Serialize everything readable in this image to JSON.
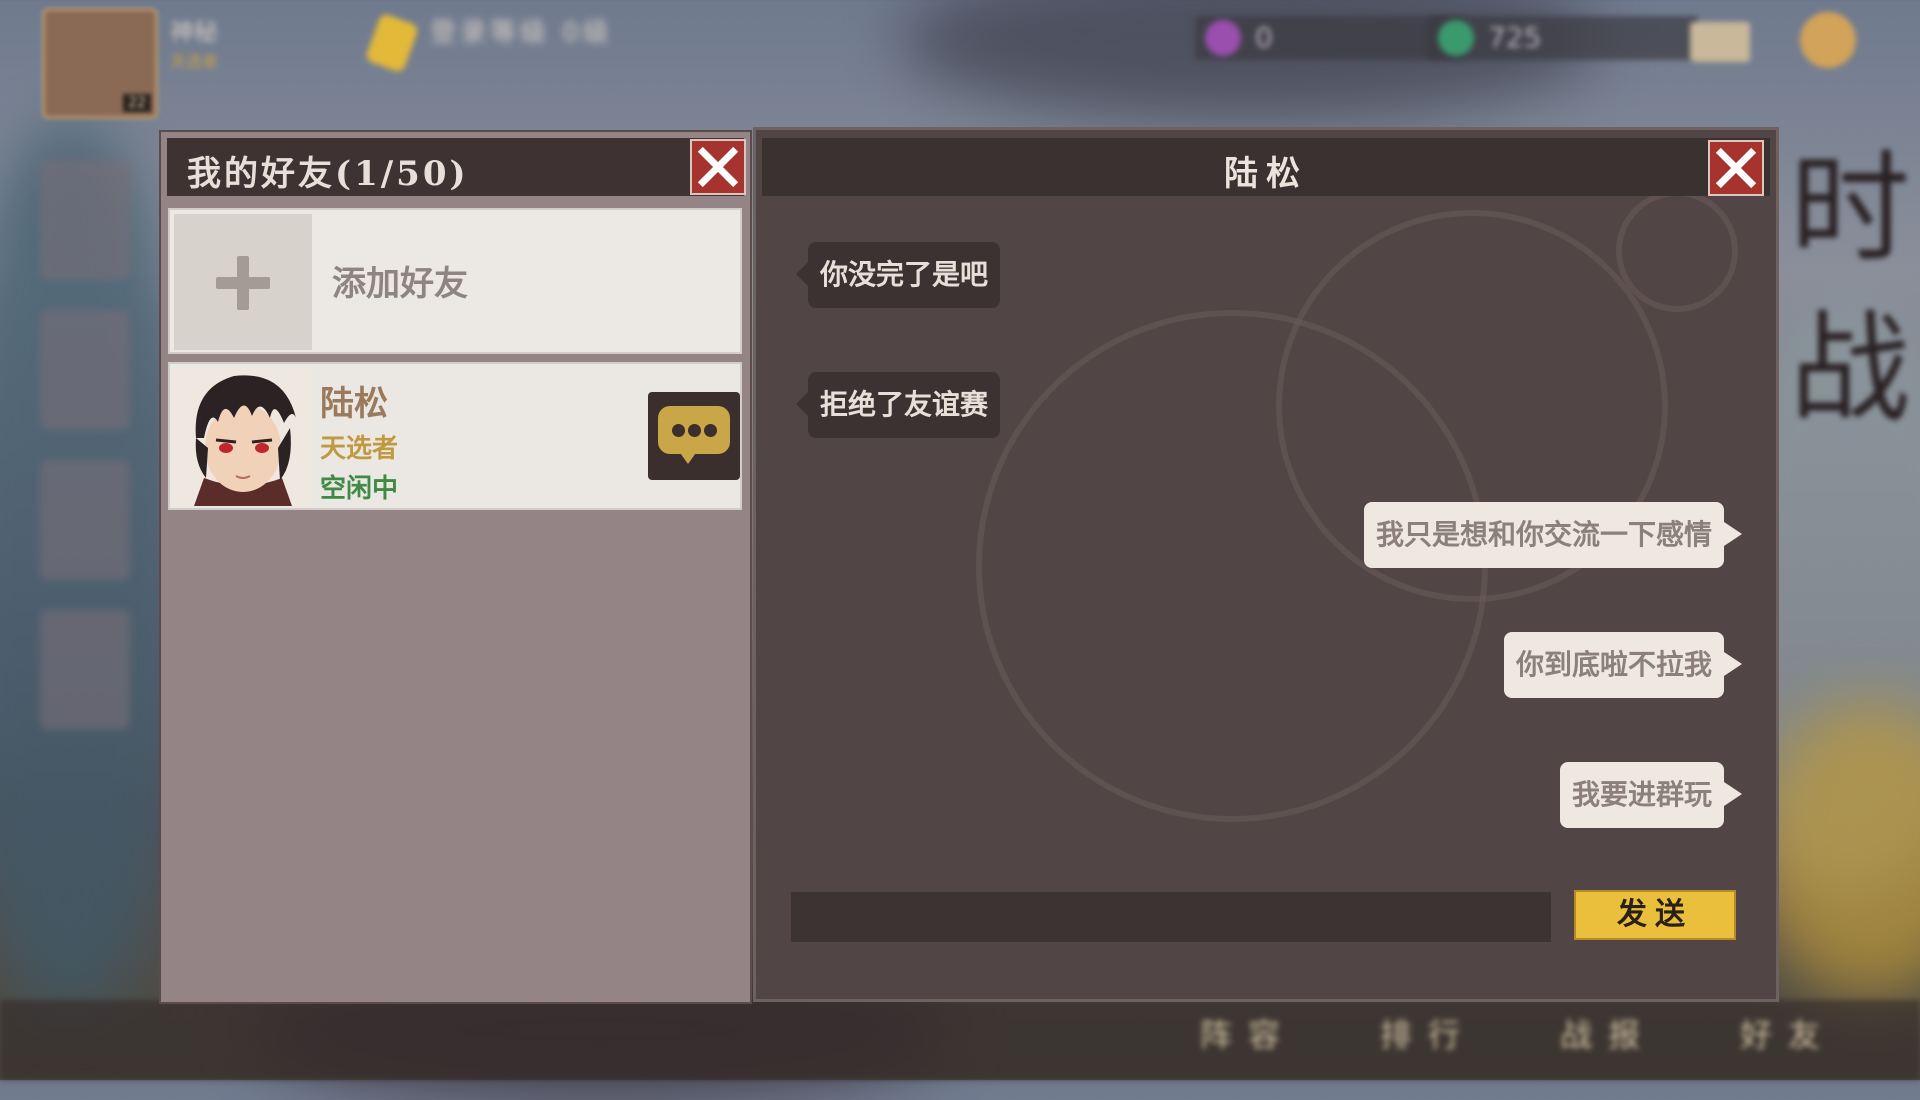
{
  "background": {
    "top_name": "神秘",
    "top_sub": "天选者",
    "top_title": "登录等级 0级",
    "level_badge": "22",
    "resource_1": "0",
    "resource_2": "725",
    "right_text": "时战",
    "bottom_tabs": [
      "阵容",
      "排行",
      "战报",
      "好友"
    ]
  },
  "friends_panel": {
    "title": "我的好友(1/50)",
    "add_friend_label": "添加好友",
    "friends": [
      {
        "name": "陆松",
        "title": "天选者",
        "status": "空闲中"
      }
    ]
  },
  "chat_panel": {
    "title": "陆松",
    "messages": [
      {
        "direction": "in",
        "text": "你没完了是吧"
      },
      {
        "direction": "in",
        "text": "拒绝了友谊赛"
      },
      {
        "direction": "out",
        "text": "我只是想和你交流一下感情"
      },
      {
        "direction": "out",
        "text": "你到底啦不拉我"
      },
      {
        "direction": "out",
        "text": "我要进群玩"
      }
    ],
    "input_value": "",
    "send_label": "发送"
  },
  "colors": {
    "accent_gold": "#eabf3b",
    "close_red": "#a7332e",
    "status_green": "#3f8a45",
    "title_gold": "#c09a40"
  },
  "icons": [
    "close-icon",
    "plus-icon",
    "chat-bubble-icon"
  ]
}
